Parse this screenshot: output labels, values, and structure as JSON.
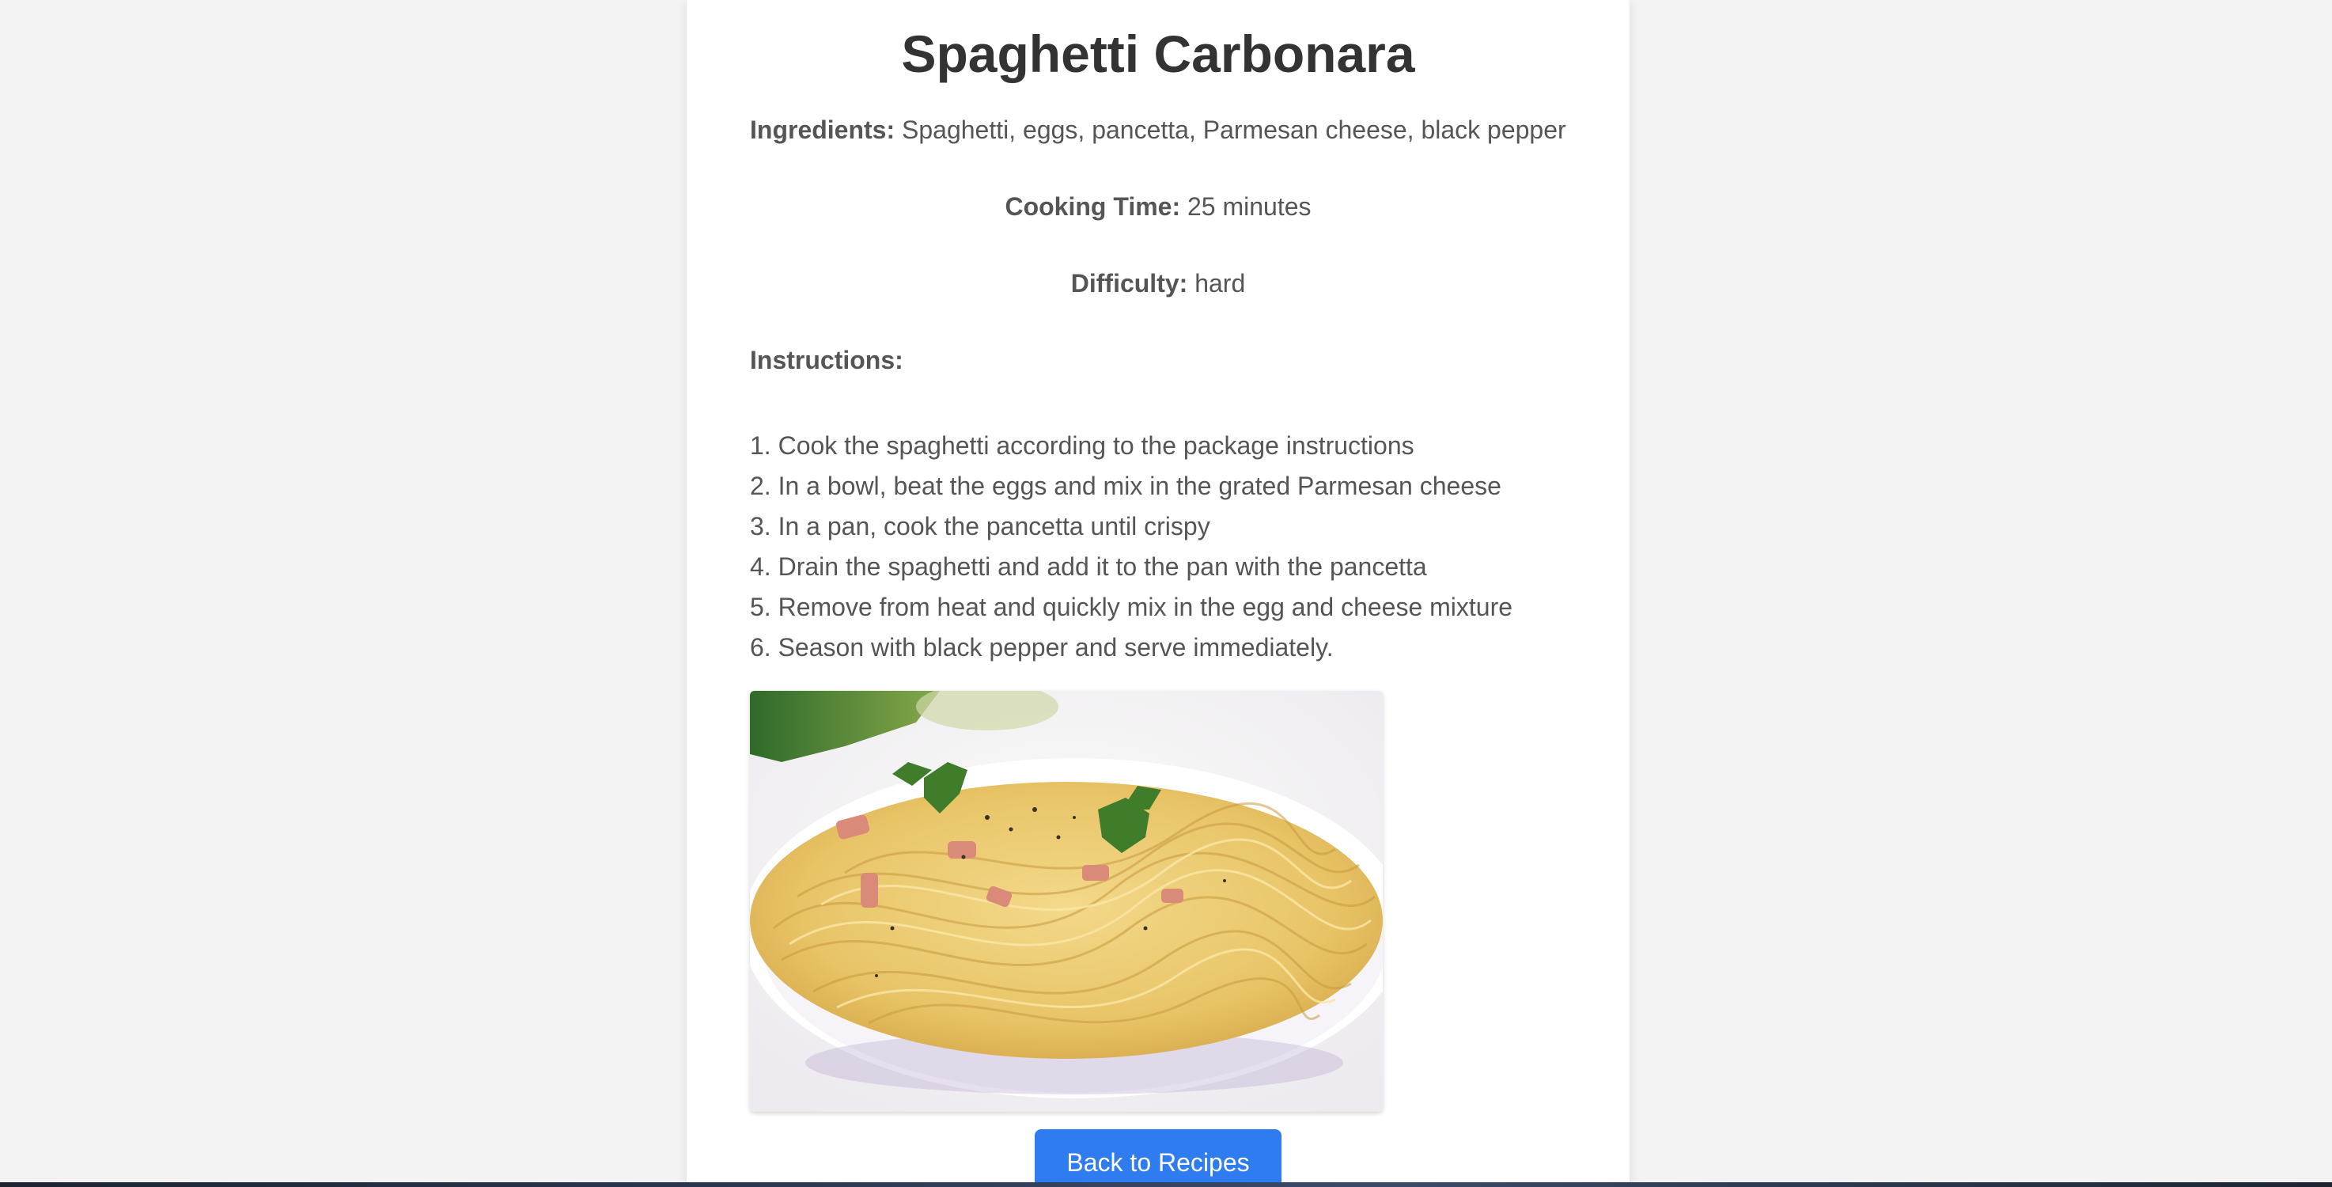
{
  "recipe": {
    "title": "Spaghetti Carbonara",
    "ingredients_label": "Ingredients:",
    "ingredients_value": "Spaghetti, eggs, pancetta, Parmesan cheese, black pepper",
    "cooking_time_label": "Cooking Time:",
    "cooking_time_value": "25 minutes",
    "difficulty_label": "Difficulty:",
    "difficulty_value": "hard",
    "instructions_label": "Instructions:",
    "steps": [
      "1. Cook the spaghetti according to the package instructions",
      "2. In a bowl, beat the eggs and mix in the grated Parmesan cheese",
      "3. In a pan, cook the pancetta until crispy",
      "4. Drain the spaghetti and add it to the pan with the pancetta",
      "5. Remove from heat and quickly mix in the egg and cheese mixture",
      "6. Season with black pepper and serve immediately."
    ],
    "image_subject": "plate of spaghetti carbonara garnished with parsley"
  },
  "actions": {
    "back_label": "Back to Recipes"
  },
  "colors": {
    "page_background": "#f3f3f3",
    "card_background": "#ffffff",
    "title_text": "#333333",
    "body_text": "#555555",
    "button_background": "#2f7cf0",
    "button_text": "#ffffff"
  }
}
